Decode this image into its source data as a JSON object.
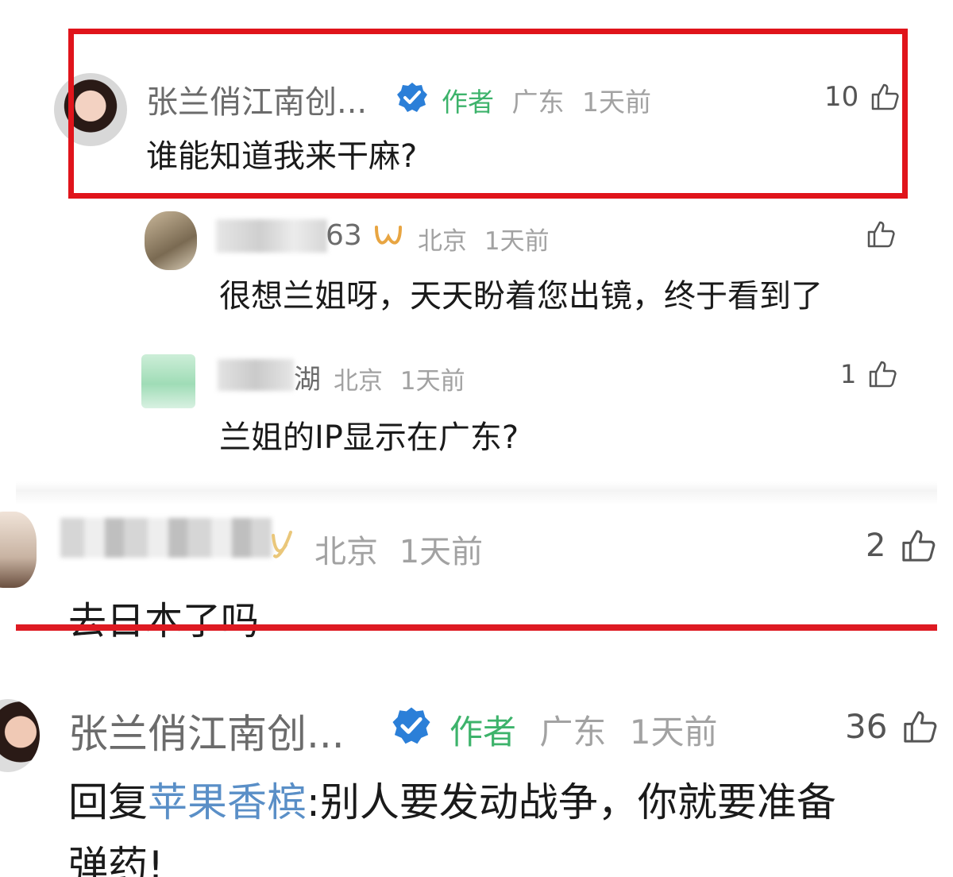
{
  "comment1": {
    "username": "张兰俏江南创...",
    "author_tag": "作者",
    "location": "广东",
    "time": "1天前",
    "likes": "10",
    "text": "谁能知道我来干麻?"
  },
  "reply1": {
    "username_visible": "63",
    "location": "北京",
    "time": "1天前",
    "likes": "",
    "text": "很想兰姐呀，天天盼着您出镜，终于看到了"
  },
  "reply2": {
    "username_visible": "湖",
    "location": "北京",
    "time": "1天前",
    "likes": "1",
    "text": "兰姐的IP显示在广东?"
  },
  "comment2": {
    "location": "北京",
    "time": "1天前",
    "likes": "2",
    "text": "去日本了吗"
  },
  "comment3": {
    "username": "张兰俏江南创...",
    "author_tag": "作者",
    "location": "广东",
    "time": "1天前",
    "likes": "36",
    "reply_prefix": "回复",
    "reply_target": "苹果香槟",
    "text_line1": ":别人要发动战争，你就要准备",
    "text_line2": "弹药!"
  },
  "icons": {
    "verified": "verified-badge-icon",
    "like": "thumbs-up-icon",
    "vip": "vip-ribbon-icon"
  },
  "colors": {
    "highlight_red": "#e0141b",
    "author_green": "#3db36b",
    "verified_blue": "#2b7fd8",
    "reply_target_blue": "#5a8fc7"
  }
}
